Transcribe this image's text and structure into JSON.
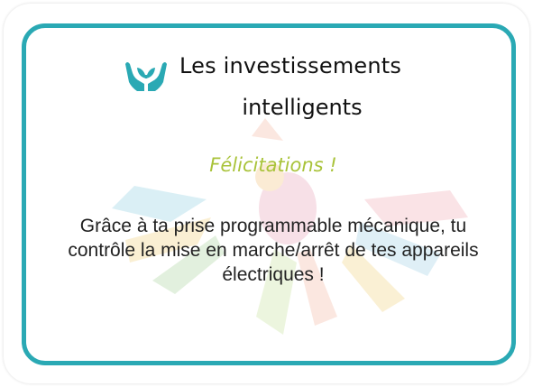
{
  "card": {
    "title_line1": "Les investissements",
    "title_line2": "intelligents",
    "congrats": "Félicitations !",
    "message": "Grâce à ta prise programmable mécanique, tu contrôle la mise en marche/arrêt de tes appareils électriques !",
    "icon": "hands-holding-plant-icon"
  },
  "colors": {
    "border": "#2aa9b4",
    "icon": "#2aa9b4",
    "congrats": "#a9c33a",
    "text": "#222222"
  }
}
